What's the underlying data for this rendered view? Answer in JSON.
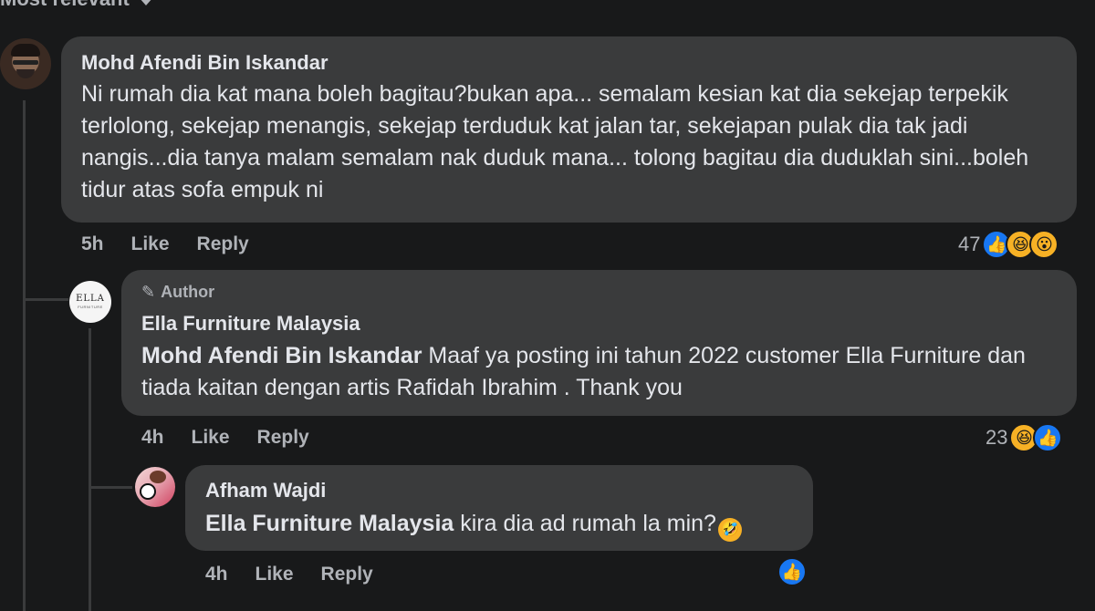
{
  "header": {
    "sort_label": "Most relevant"
  },
  "comments": [
    {
      "author": "Mohd Afendi Bin Iskandar",
      "text": "Ni rumah dia kat mana boleh bagitau?bukan apa... semalam kesian kat dia sekejap terpekik terlolong, sekejap menangis, sekejap terduduk kat jalan tar, sekejapan pulak dia tak jadi nangis...dia tanya malam semalam nak duduk mana... tolong bagitau dia duduklah sini...boleh tidur atas sofa empuk ni",
      "time": "5h",
      "like_label": "Like",
      "reply_label": "Reply",
      "reaction_count": "47",
      "reactions": [
        "like-icon",
        "haha-icon",
        "wow-icon"
      ]
    },
    {
      "badge": "Author",
      "author": "Ella Furniture Malaysia",
      "avatar_text": "ELLA",
      "avatar_subtext": "FURNITURE",
      "mention": "Mohd Afendi Bin Iskandar",
      "text": " Maaf ya posting ini tahun 2022 customer Ella Furniture dan tiada kaitan dengan artis Rafidah Ibrahim . Thank you",
      "time": "4h",
      "like_label": "Like",
      "reply_label": "Reply",
      "reaction_count": "23",
      "reactions": [
        "haha-icon",
        "like-icon"
      ]
    },
    {
      "author": "Afham Wajdi",
      "mention": "Ella Furniture Malaysia",
      "text": " kira dia ad rumah la min?",
      "inline_emoji": "rofl-emoji",
      "time": "4h",
      "like_label": "Like",
      "reply_label": "Reply",
      "reactions": [
        "like-icon"
      ]
    }
  ],
  "colors": {
    "background": "#18191a",
    "bubble": "#3a3b3c",
    "text": "#e4e6eb",
    "muted": "#b0b3b8",
    "like_blue": "#1877f2",
    "emoji_yellow": "#f7b125"
  }
}
